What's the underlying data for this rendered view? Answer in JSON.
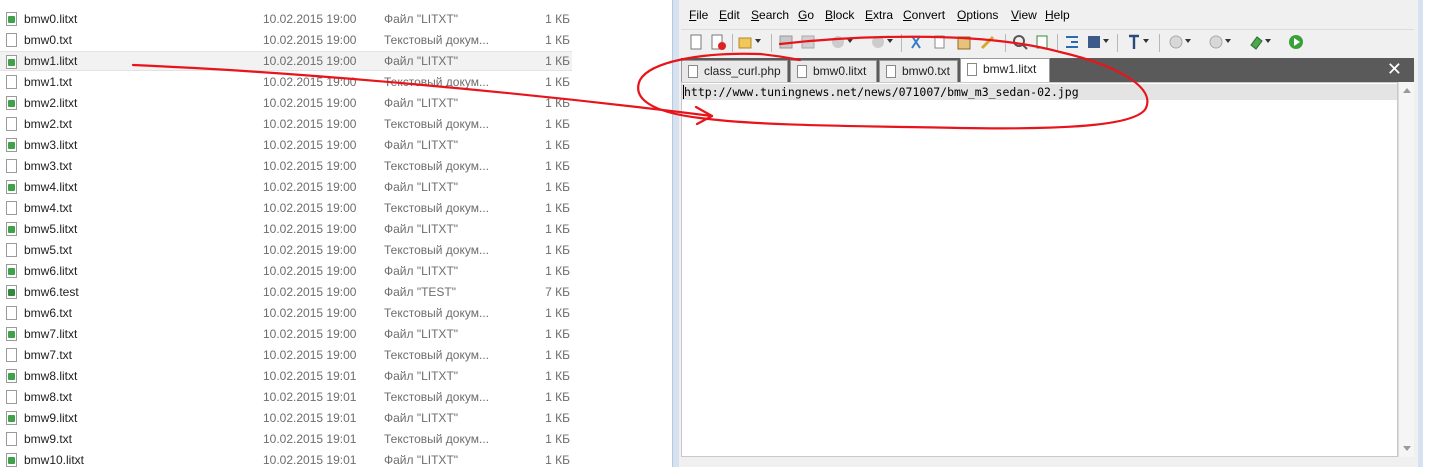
{
  "explorer": {
    "files": [
      {
        "name": "bmw0.litxt",
        "date": "10.02.2015 19:00",
        "type": "Файл \"LITXT\"",
        "size": "1 КБ",
        "kind": "litxt"
      },
      {
        "name": "bmw0.txt",
        "date": "10.02.2015 19:00",
        "type": "Текстовый докум...",
        "size": "1 КБ",
        "kind": "txt"
      },
      {
        "name": "bmw1.litxt",
        "date": "10.02.2015 19:00",
        "type": "Файл \"LITXT\"",
        "size": "1 КБ",
        "kind": "litxt",
        "selected": true
      },
      {
        "name": "bmw1.txt",
        "date": "10.02.2015 19:00",
        "type": "Текстовый докум...",
        "size": "1 КБ",
        "kind": "txt"
      },
      {
        "name": "bmw2.litxt",
        "date": "10.02.2015 19:00",
        "type": "Файл \"LITXT\"",
        "size": "1 КБ",
        "kind": "litxt"
      },
      {
        "name": "bmw2.txt",
        "date": "10.02.2015 19:00",
        "type": "Текстовый докум...",
        "size": "1 КБ",
        "kind": "txt"
      },
      {
        "name": "bmw3.litxt",
        "date": "10.02.2015 19:00",
        "type": "Файл \"LITXT\"",
        "size": "1 КБ",
        "kind": "litxt"
      },
      {
        "name": "bmw3.txt",
        "date": "10.02.2015 19:00",
        "type": "Текстовый докум...",
        "size": "1 КБ",
        "kind": "txt"
      },
      {
        "name": "bmw4.litxt",
        "date": "10.02.2015 19:00",
        "type": "Файл \"LITXT\"",
        "size": "1 КБ",
        "kind": "litxt"
      },
      {
        "name": "bmw4.txt",
        "date": "10.02.2015 19:00",
        "type": "Текстовый докум...",
        "size": "1 КБ",
        "kind": "txt"
      },
      {
        "name": "bmw5.litxt",
        "date": "10.02.2015 19:00",
        "type": "Файл \"LITXT\"",
        "size": "1 КБ",
        "kind": "litxt"
      },
      {
        "name": "bmw5.txt",
        "date": "10.02.2015 19:00",
        "type": "Текстовый докум...",
        "size": "1 КБ",
        "kind": "txt"
      },
      {
        "name": "bmw6.litxt",
        "date": "10.02.2015 19:00",
        "type": "Файл \"LITXT\"",
        "size": "1 КБ",
        "kind": "litxt"
      },
      {
        "name": "bmw6.test",
        "date": "10.02.2015 19:00",
        "type": "Файл \"TEST\"",
        "size": "7 КБ",
        "kind": "test"
      },
      {
        "name": "bmw6.txt",
        "date": "10.02.2015 19:00",
        "type": "Текстовый докум...",
        "size": "1 КБ",
        "kind": "txt"
      },
      {
        "name": "bmw7.litxt",
        "date": "10.02.2015 19:00",
        "type": "Файл \"LITXT\"",
        "size": "1 КБ",
        "kind": "litxt"
      },
      {
        "name": "bmw7.txt",
        "date": "10.02.2015 19:00",
        "type": "Текстовый докум...",
        "size": "1 КБ",
        "kind": "txt"
      },
      {
        "name": "bmw8.litxt",
        "date": "10.02.2015 19:01",
        "type": "Файл \"LITXT\"",
        "size": "1 КБ",
        "kind": "litxt"
      },
      {
        "name": "bmw8.txt",
        "date": "10.02.2015 19:01",
        "type": "Текстовый докум...",
        "size": "1 КБ",
        "kind": "txt"
      },
      {
        "name": "bmw9.litxt",
        "date": "10.02.2015 19:01",
        "type": "Файл \"LITXT\"",
        "size": "1 КБ",
        "kind": "litxt"
      },
      {
        "name": "bmw9.txt",
        "date": "10.02.2015 19:01",
        "type": "Текстовый докум...",
        "size": "1 КБ",
        "kind": "txt"
      },
      {
        "name": "bmw10.litxt",
        "date": "10.02.2015 19:01",
        "type": "Файл \"LITXT\"",
        "size": "1 КБ",
        "kind": "litxt"
      }
    ]
  },
  "editor": {
    "menu": [
      {
        "label": "File",
        "access": "F",
        "rest": "ile"
      },
      {
        "label": "Edit",
        "access": "E",
        "rest": "dit"
      },
      {
        "label": "Search",
        "access": "S",
        "rest": "earch"
      },
      {
        "label": "Go",
        "access": "G",
        "rest": "o"
      },
      {
        "label": "Block",
        "access": "B",
        "rest": "lock"
      },
      {
        "label": "Extra",
        "access": "E",
        "rest": "xtra"
      },
      {
        "label": "Convert",
        "access": "C",
        "rest": "onvert"
      },
      {
        "label": "Options",
        "access": "O",
        "rest": "ptions"
      },
      {
        "label": "View",
        "access": "V",
        "rest": "iew"
      },
      {
        "label": "Help",
        "access": "H",
        "rest": "elp"
      }
    ],
    "toolbar_icons": [
      "new-document-icon",
      "close-document-icon",
      "open-folder-icon",
      "save-icon",
      "save-all-icon",
      "undo-icon",
      "redo-icon",
      "cut-icon",
      "copy-icon",
      "paste-icon",
      "clear-icon",
      "find-icon",
      "replace-icon",
      "indent-icon",
      "block-icon",
      "font-icon",
      "zoom-in-icon",
      "zoom-out-icon",
      "bookmark-icon",
      "run-icon"
    ],
    "tabs": [
      {
        "label": "class_curl.php"
      },
      {
        "label": "bmw0.litxt"
      },
      {
        "label": "bmw0.txt"
      },
      {
        "label": "bmw1.litxt",
        "active": true
      }
    ],
    "content_line": "http://www.tuningnews.net/news/071007/bmw_m3_sedan-02.jpg",
    "close_glyph": "✕"
  },
  "colors": {
    "annotation_red": "#e8141b",
    "litxt_icon_green": "#3fa14a",
    "tabbar_dark": "#5a5a5a"
  }
}
